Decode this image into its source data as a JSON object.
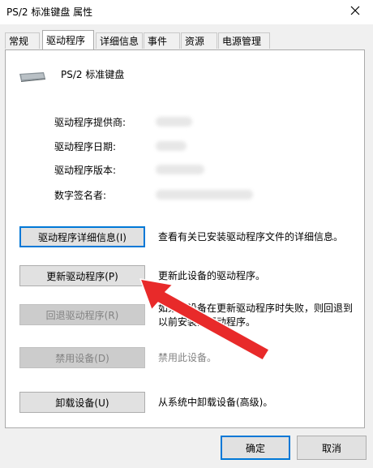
{
  "window": {
    "title": "PS/2 标准键盘 属性",
    "close_icon": "close-icon"
  },
  "tabs": [
    {
      "label": "常规",
      "active": false
    },
    {
      "label": "驱动程序",
      "active": true
    },
    {
      "label": "详细信息",
      "active": false
    },
    {
      "label": "事件",
      "active": false
    },
    {
      "label": "资源",
      "active": false
    },
    {
      "label": "电源管理",
      "active": false
    }
  ],
  "device": {
    "name": "PS/2 标准键盘",
    "icon": "keyboard-icon"
  },
  "fields": [
    {
      "label": "驱动程序提供商:"
    },
    {
      "label": "驱动程序日期:"
    },
    {
      "label": "驱动程序版本:"
    },
    {
      "label": "数字签名者:"
    }
  ],
  "actions": [
    {
      "label": "驱动程序详细信息(I)",
      "description": "查看有关已安装驱动程序文件的详细信息。",
      "enabled": true
    },
    {
      "label": "更新驱动程序(P)",
      "description": "更新此设备的驱动程序。",
      "enabled": true
    },
    {
      "label": "回退驱动程序(R)",
      "description": "如果该设备在更新驱动程序时失败，则回退到以前安装的驱动程序。",
      "enabled": false
    },
    {
      "label": "禁用设备(D)",
      "description": "禁用此设备。",
      "enabled": false
    },
    {
      "label": "卸载设备(U)",
      "description": "从系统中卸载设备(高级)。",
      "enabled": true
    }
  ],
  "footer": {
    "ok_label": "确定",
    "cancel_label": "取消"
  },
  "annotation": {
    "arrow_color": "#e82a2a"
  }
}
